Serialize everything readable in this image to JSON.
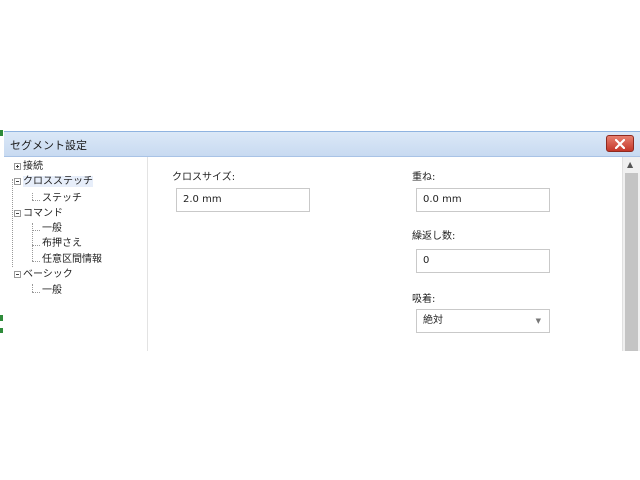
{
  "window": {
    "title": "セグメント設定"
  },
  "tree": {
    "items": [
      {
        "label": "接続"
      },
      {
        "label": "クロスステッチ"
      },
      {
        "label": "ステッチ"
      },
      {
        "label": "コマンド"
      },
      {
        "label": "一般"
      },
      {
        "label": "布押さえ"
      },
      {
        "label": "任意区間情報"
      },
      {
        "label": "ベーシック"
      },
      {
        "label": "一般"
      }
    ],
    "selected": "クロスステッチ"
  },
  "form": {
    "cross_size": {
      "label": "クロスサイズ:",
      "value": "2.0 mm"
    },
    "overlap": {
      "label": "重ね:",
      "value": "0.0 mm"
    },
    "repeat_count": {
      "label": "繰返し数:",
      "value": "0"
    },
    "snap": {
      "label": "吸着:",
      "value": "絶対"
    }
  },
  "colors": {
    "titlebar": "#c8daf1",
    "close": "#c4372a",
    "selection": "#e7eefa"
  }
}
